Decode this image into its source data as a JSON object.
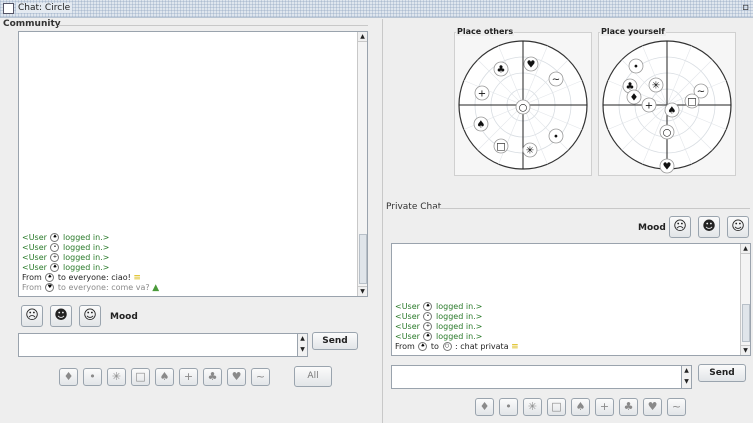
{
  "window": {
    "title": "Chat: Circle"
  },
  "community": {
    "label": "Community",
    "messages": [
      {
        "pre": "<User ",
        "sym": "♠",
        "post": " logged in.>",
        "style": "green"
      },
      {
        "pre": "<User ",
        "sym": "•",
        "post": " logged in.>",
        "style": "green"
      },
      {
        "pre": "<User ",
        "sym": "+",
        "post": " logged in.>",
        "style": "green"
      },
      {
        "pre": "<User ",
        "sym": "♠",
        "post": " logged in.>",
        "style": "green"
      },
      {
        "pre": "From ",
        "sym": "♠",
        "post": " to everyone: ciao! ",
        "emo": "≡",
        "style": "black"
      },
      {
        "pre": "From ",
        "sym": "♥",
        "post": " to everyone: come va? ",
        "emo": "▲",
        "style": "gray"
      }
    ],
    "mood_label": "Mood",
    "send_label": "Send",
    "all_label": "All",
    "input_value": ""
  },
  "mood_icons": [
    "confused-face-icon",
    "neutral-face-icon",
    "thinking-face-icon"
  ],
  "mood_glyphs": [
    "☹",
    "☻",
    "☺"
  ],
  "symbols": [
    "♦",
    "•",
    "✳",
    "□",
    "♠",
    "+",
    "♣",
    "♥",
    "~"
  ],
  "place_others": {
    "label": "Place others",
    "marks": [
      "♣",
      "♥",
      "~",
      "+",
      "○",
      "♠",
      "•",
      "□",
      "✳"
    ]
  },
  "place_yourself": {
    "label": "Place yourself",
    "marks": [
      "•",
      "✳",
      "♣",
      "♦",
      "+",
      "♠",
      "~",
      "□",
      "○",
      "♥"
    ]
  },
  "private_chat": {
    "label": "Private Chat",
    "mood_label": "Mood",
    "messages": [
      {
        "pre": "<User ",
        "sym": "♠",
        "post": " logged in.>",
        "style": "green"
      },
      {
        "pre": "<User ",
        "sym": "•",
        "post": " logged in.>",
        "style": "green"
      },
      {
        "pre": "<User ",
        "sym": "+",
        "post": " logged in.>",
        "style": "green"
      },
      {
        "pre": "<User ",
        "sym": "♠",
        "post": " logged in.>",
        "style": "green"
      },
      {
        "pre": "From ",
        "sym": "♠",
        "post": " to ",
        "sym2": "○",
        "post2": " : chat privata ",
        "emo": "≡",
        "style": "black"
      }
    ],
    "send_label": "Send",
    "input_value": ""
  },
  "colors": {
    "green_text": "#2a7a2a",
    "gray_text": "#8a8a8a",
    "emoticon_gold": "#d9b600"
  }
}
